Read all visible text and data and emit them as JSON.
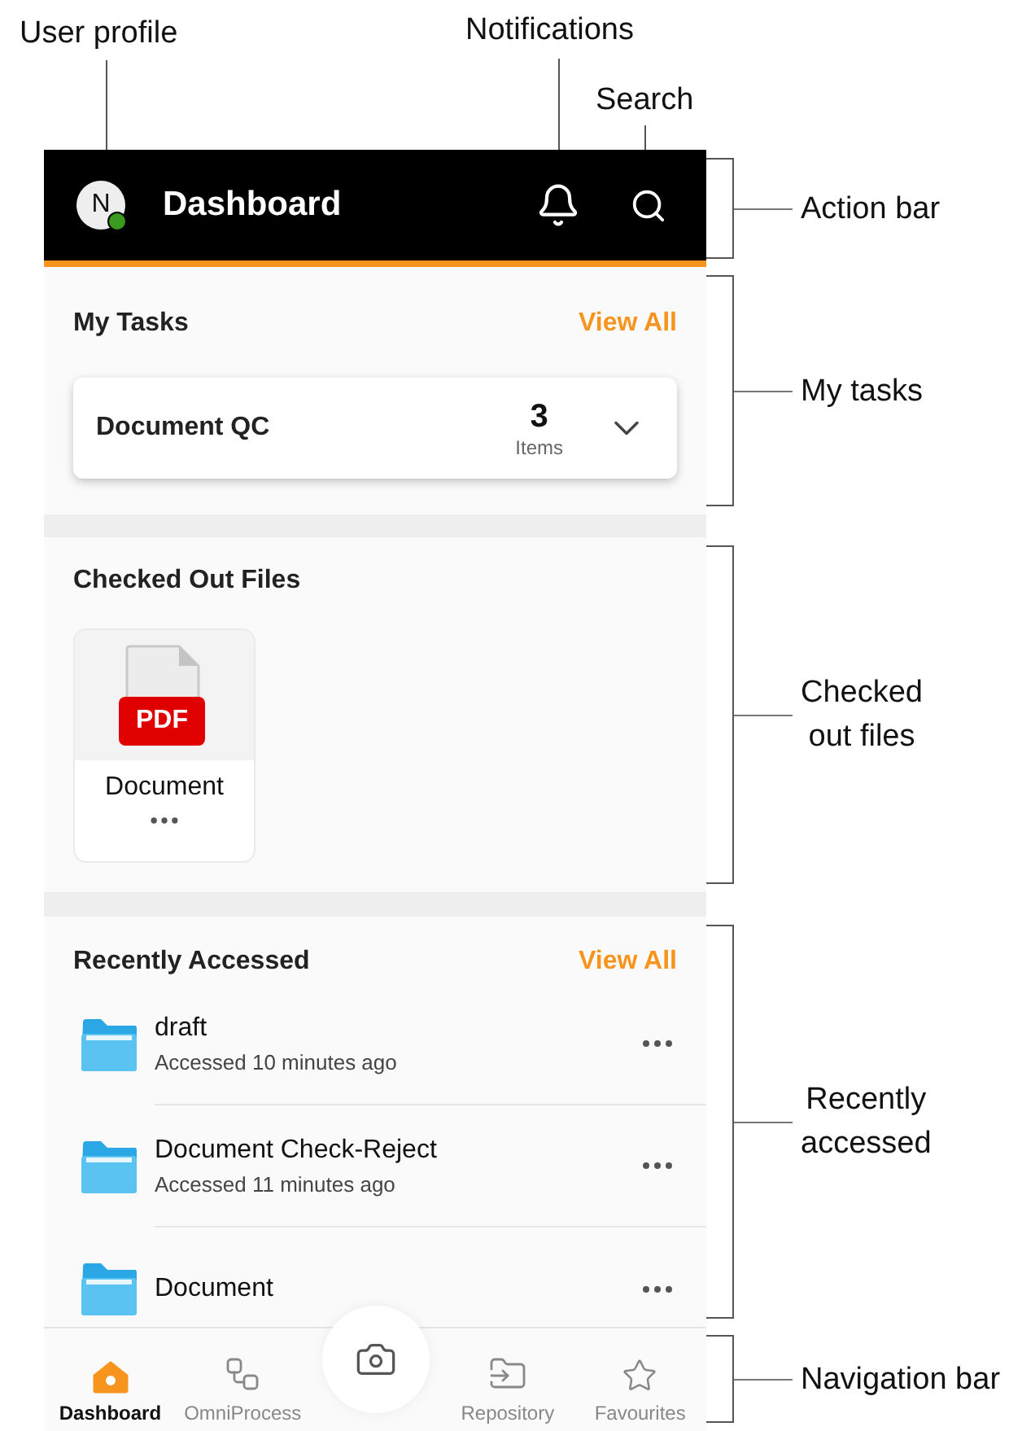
{
  "top_callouts": [
    {
      "label": "User profile",
      "kind": "profile"
    },
    {
      "label": "Notifications",
      "kind": "notifications"
    },
    {
      "label": "Search",
      "kind": "search"
    }
  ],
  "side_callouts": [
    "Action bar",
    "My tasks",
    "Checked\nout files",
    "Recently\naccessed",
    "Navigation bar"
  ],
  "action_bar": {
    "avatar": "N",
    "online": true,
    "title": "Dashboard"
  },
  "my_tasks": {
    "title": "My Tasks",
    "view_all": "View All",
    "tasks": [
      {
        "name": "Document QC",
        "count": "3",
        "unit": "Items",
        "expanded": false
      }
    ]
  },
  "checked_out": {
    "title": "Checked Out Files",
    "files": [
      {
        "name": "Document",
        "badge": "PDF"
      }
    ]
  },
  "recent": {
    "title": "Recently Accessed",
    "view_all": "View All",
    "items": [
      {
        "name": "draft",
        "accessed": "Accessed 10 minutes ago"
      },
      {
        "name": "Document Check-Reject",
        "accessed": "Accessed 11 minutes ago"
      },
      {
        "name": "Document"
      }
    ]
  },
  "nav": [
    {
      "kind": "home",
      "label": "Dashboard",
      "selected": true
    },
    {
      "kind": "process",
      "label": "OmniProcess",
      "selected": false
    },
    {
      "kind": "camera",
      "selected": false
    },
    {
      "kind": "repository",
      "label": "Repository",
      "selected": false
    },
    {
      "kind": "favourites",
      "label": "Favourites",
      "selected": false
    }
  ]
}
